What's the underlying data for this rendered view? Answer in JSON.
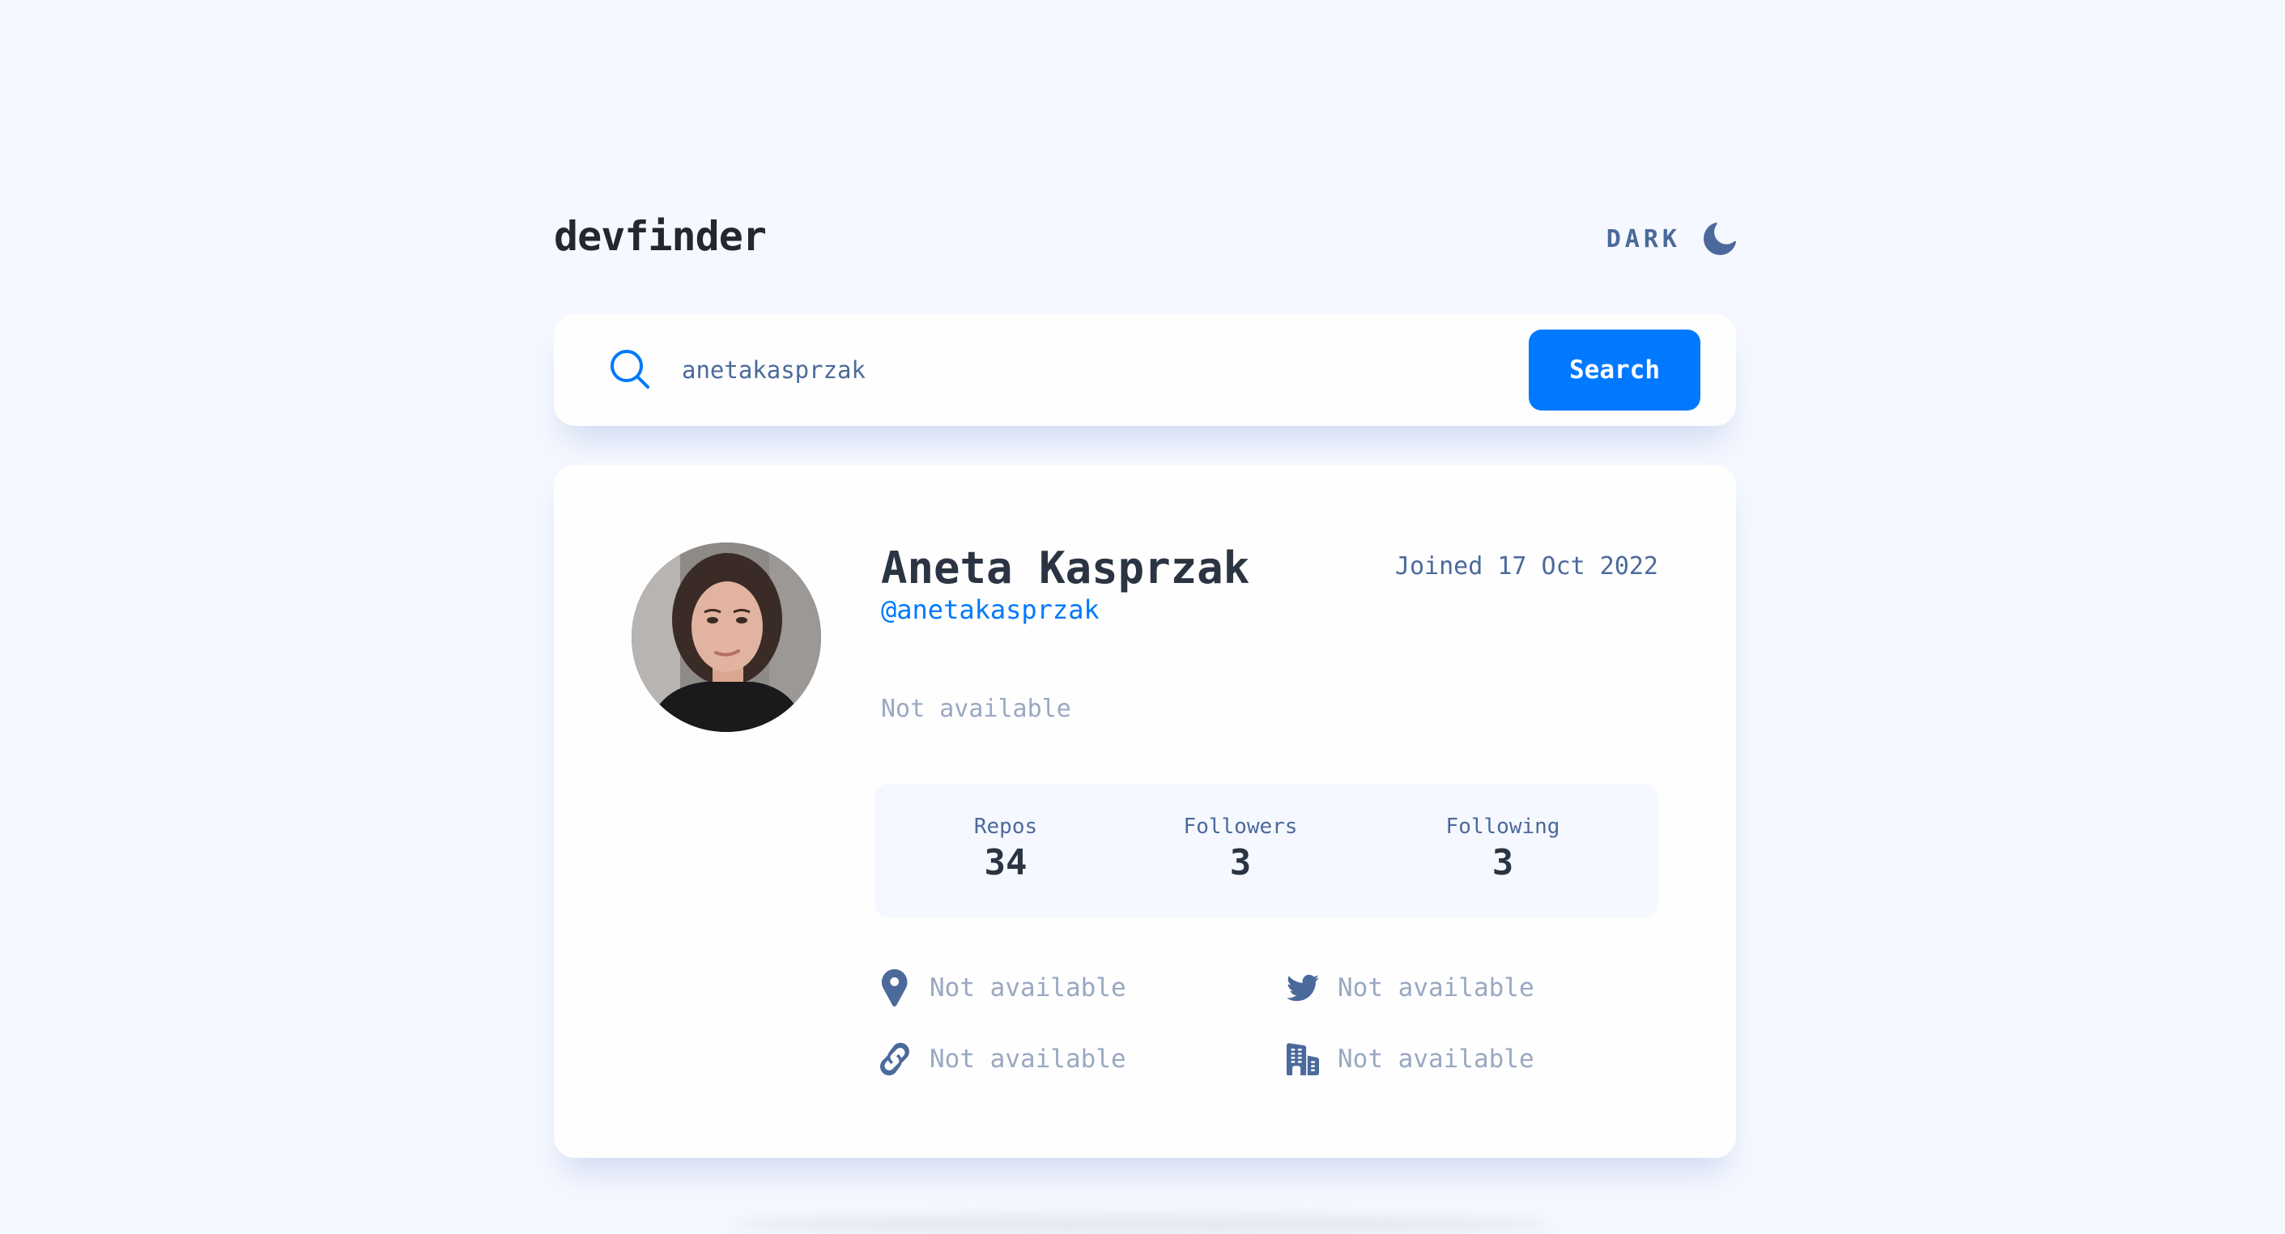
{
  "app": {
    "logo": "devfinder",
    "theme_toggle_label": "DARK",
    "icons": {
      "theme": "moon-icon",
      "search": "search-icon",
      "location": "location-pin-icon",
      "twitter": "twitter-icon",
      "website": "link-icon",
      "company": "building-icon"
    },
    "colors": {
      "accent": "#0079FF",
      "background": "#F5F8FF",
      "card": "#FEFEFE",
      "text_dark": "#2B3442",
      "text_muted": "#4B6A9B",
      "text_unavailable": "#9AA8C2"
    }
  },
  "search": {
    "value": "anetakasprzak",
    "placeholder": "",
    "button_label": "Search"
  },
  "profile": {
    "name": "Aneta Kasprzak",
    "login": "@anetakasprzak",
    "joined": "Joined 17 Oct 2022",
    "bio": "Not available",
    "stats": [
      {
        "label": "Repos",
        "value": "34"
      },
      {
        "label": "Followers",
        "value": "3"
      },
      {
        "label": "Following",
        "value": "3"
      }
    ],
    "links": {
      "location": "Not available",
      "twitter": "Not available",
      "website": "Not available",
      "company": "Not available"
    }
  }
}
